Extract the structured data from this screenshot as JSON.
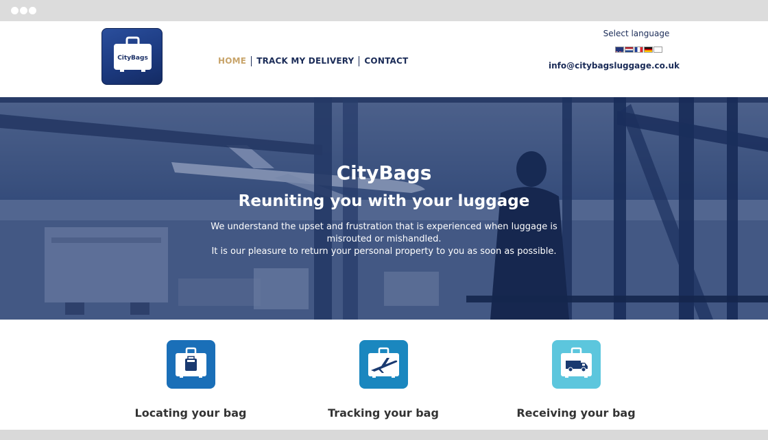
{
  "brand": {
    "logo_text": "CityBags"
  },
  "nav": {
    "items": [
      {
        "label": "HOME"
      },
      {
        "label": "TRACK MY DELIVERY"
      },
      {
        "label": "CONTACT"
      }
    ]
  },
  "header": {
    "language_label": "Select language",
    "languages": [
      "english-flag-icon",
      "dutch-flag-icon",
      "french-flag-icon",
      "german-flag-icon",
      "korean-flag-icon"
    ],
    "email": "info@citybagsluggage.co.uk"
  },
  "hero": {
    "title": "CityBags",
    "subtitle": "Reuniting you with your luggage",
    "line1": "We understand the upset and frustration that is experienced when luggage is misrouted or mishandled.",
    "line2": "It is our pleasure to return your personal property to you as soon as possible."
  },
  "features": [
    {
      "label": "Locating your bag",
      "icon": "luggage-icon",
      "color": "#1a6fb8"
    },
    {
      "label": "Tracking your bag",
      "icon": "airplane-icon",
      "color": "#1a87bf"
    },
    {
      "label": "Receiving your bag",
      "icon": "van-icon",
      "color": "#5cc6dd"
    }
  ],
  "colors": {
    "nav_active": "#c8a46a",
    "nav_text": "#1a2b57",
    "hero_overlay": "#1f3565"
  }
}
